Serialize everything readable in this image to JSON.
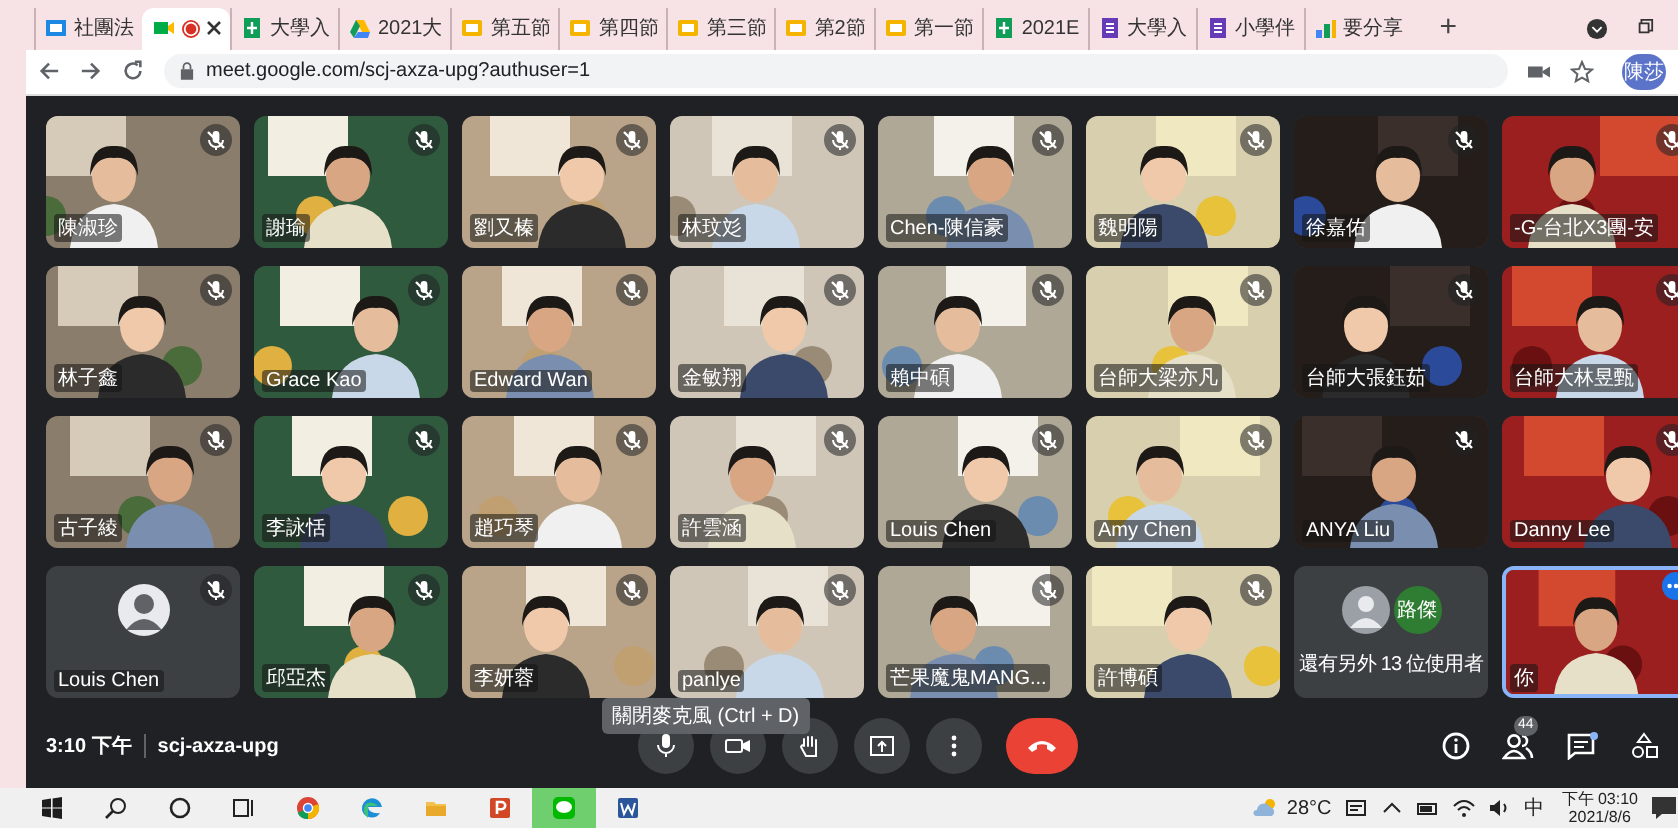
{
  "browser": {
    "tabs": [
      {
        "kind": "classroom",
        "label": "社團法",
        "selected": false,
        "recording": false
      },
      {
        "kind": "meet",
        "selected": true,
        "recording": true
      },
      {
        "kind": "sheets",
        "label": "大學入",
        "selected": false,
        "recording": false
      },
      {
        "kind": "drive",
        "label": "2021大",
        "selected": false,
        "recording": false
      },
      {
        "kind": "slides",
        "label": "第五節",
        "selected": false,
        "recording": false
      },
      {
        "kind": "slides",
        "label": "第四節",
        "selected": false,
        "recording": false
      },
      {
        "kind": "slides",
        "label": "第三節",
        "selected": false,
        "recording": false
      },
      {
        "kind": "slides",
        "label": "第2節",
        "selected": false,
        "recording": false
      },
      {
        "kind": "slides",
        "label": "第一節",
        "selected": false,
        "recording": false
      },
      {
        "kind": "sheets",
        "label": "2021E",
        "selected": false,
        "recording": false
      },
      {
        "kind": "forms",
        "label": "大學入",
        "selected": false,
        "recording": false
      },
      {
        "kind": "forms",
        "label": "小學伴",
        "selected": false,
        "recording": false
      },
      {
        "kind": "photos",
        "label": "要分享",
        "selected": false,
        "recording": false
      }
    ],
    "new_tab": "+",
    "url": "meet.google.com/scj-axza-upg?authuser=1",
    "profile": "陳莎"
  },
  "tiles": [
    {
      "kind": "video",
      "name": "陳淑珍",
      "muted": true
    },
    {
      "kind": "video",
      "name": "謝瑜",
      "muted": true
    },
    {
      "kind": "video",
      "name": "劉又榛",
      "muted": true
    },
    {
      "kind": "video",
      "name": "林玟彣",
      "muted": true
    },
    {
      "kind": "video",
      "name": "Chen-陳信豪",
      "muted": true
    },
    {
      "kind": "video",
      "name": "魏明陽",
      "muted": true
    },
    {
      "kind": "video",
      "name": "徐嘉佑",
      "muted": true
    },
    {
      "kind": "video",
      "name": "-G-台北X3團-安",
      "muted": true
    },
    {
      "kind": "video",
      "name": "林子鑫",
      "muted": true
    },
    {
      "kind": "video",
      "name": "Grace Kao",
      "muted": true
    },
    {
      "kind": "video",
      "name": "Edward Wan",
      "muted": true
    },
    {
      "kind": "video",
      "name": "金敏翔",
      "muted": true
    },
    {
      "kind": "video",
      "name": "賴中碩",
      "muted": true
    },
    {
      "kind": "video",
      "name": "台師大梁亦凡",
      "muted": true
    },
    {
      "kind": "video",
      "name": "台師大張鈺茹",
      "muted": true
    },
    {
      "kind": "video",
      "name": "台師大林昱甄",
      "muted": true
    },
    {
      "kind": "video",
      "name": "古子綾",
      "muted": true
    },
    {
      "kind": "video",
      "name": "李詠恬",
      "muted": true
    },
    {
      "kind": "video",
      "name": "趙巧琴",
      "muted": true
    },
    {
      "kind": "video",
      "name": "許雲涵",
      "muted": true
    },
    {
      "kind": "video",
      "name": "Louis Chen",
      "muted": true
    },
    {
      "kind": "video",
      "name": "Amy Chen",
      "muted": true
    },
    {
      "kind": "video",
      "name": "ANYA Liu",
      "muted": true
    },
    {
      "kind": "video",
      "name": "Danny Lee",
      "muted": true
    },
    {
      "kind": "avatar",
      "name": "Louis Chen",
      "muted": true
    },
    {
      "kind": "video",
      "name": "邱亞杰",
      "muted": true
    },
    {
      "kind": "video",
      "name": "李妍蓉",
      "muted": true
    },
    {
      "kind": "video",
      "name": "panlye",
      "muted": true
    },
    {
      "kind": "video",
      "name": "芒果魔鬼MANG...",
      "muted": true
    },
    {
      "kind": "video",
      "name": "許博碩",
      "muted": true
    },
    {
      "kind": "more",
      "name": "還有另外 13 位使用者",
      "avatar_text": "路傑",
      "muted": false
    },
    {
      "kind": "self",
      "name": "你",
      "muted": false
    }
  ],
  "tooltip": "關閉麥克風 (Ctrl + D)",
  "meeting": {
    "time": "3:10 下午",
    "code": "scj-axza-upg",
    "participants_badge": "44"
  },
  "taskbar": {
    "temperature": "28°C",
    "ime": "中",
    "time": "下午 03:10",
    "date": "2021/8/6"
  }
}
